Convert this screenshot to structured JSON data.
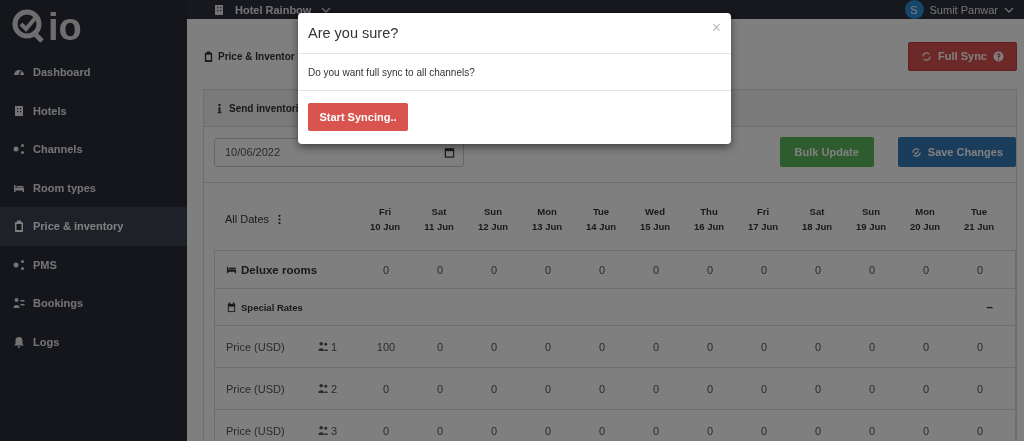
{
  "sidebar": {
    "logo": "io",
    "items": [
      {
        "label": "Dashboard",
        "selected": false
      },
      {
        "label": "Hotels",
        "selected": false
      },
      {
        "label": "Channels",
        "selected": false
      },
      {
        "label": "Room types",
        "selected": false
      },
      {
        "label": "Price & inventory",
        "selected": true
      },
      {
        "label": "PMS",
        "selected": false
      },
      {
        "label": "Bookings",
        "selected": false
      },
      {
        "label": "Logs",
        "selected": false
      }
    ]
  },
  "topbar": {
    "hotel": "Hotel Rainbow",
    "user": {
      "initial": "S",
      "name": "Sumit Panwar"
    }
  },
  "page": {
    "title": "Price & Inventor",
    "full_sync": "Full Sync",
    "card": {
      "title": "Send inventori",
      "date": "10/06/2022",
      "bulk_update": "Bulk Update",
      "save_changes": "Save Changes",
      "all_dates": "All Dates",
      "dates": [
        {
          "day": "Fri",
          "date": "10 Jun"
        },
        {
          "day": "Sat",
          "date": "11 Jun"
        },
        {
          "day": "Sun",
          "date": "12 Jun"
        },
        {
          "day": "Mon",
          "date": "13 Jun"
        },
        {
          "day": "Tue",
          "date": "14 Jun"
        },
        {
          "day": "Wed",
          "date": "15 Jun"
        },
        {
          "day": "Thu",
          "date": "16 Jun"
        },
        {
          "day": "Fri",
          "date": "17 Jun"
        },
        {
          "day": "Sat",
          "date": "18 Jun"
        },
        {
          "day": "Sun",
          "date": "19 Jun"
        },
        {
          "day": "Mon",
          "date": "20 Jun"
        },
        {
          "day": "Tue",
          "date": "21 Jun"
        }
      ],
      "room": {
        "name": "Deluxe rooms",
        "values": [
          "0",
          "0",
          "0",
          "0",
          "0",
          "0",
          "0",
          "0",
          "0",
          "0",
          "0",
          "0"
        ]
      },
      "special_rates": {
        "title": "Special Rates",
        "collapse": "–"
      },
      "rows": [
        {
          "label": "Price (USD)",
          "guests": "1",
          "values": [
            "100",
            "0",
            "0",
            "0",
            "0",
            "0",
            "0",
            "0",
            "0",
            "0",
            "0",
            "0"
          ]
        },
        {
          "label": "Price (USD)",
          "guests": "2",
          "values": [
            "0",
            "0",
            "0",
            "0",
            "0",
            "0",
            "0",
            "0",
            "0",
            "0",
            "0",
            "0"
          ]
        },
        {
          "label": "Price (USD)",
          "guests": "3",
          "values": [
            "0",
            "0",
            "0",
            "0",
            "0",
            "0",
            "0",
            "0",
            "0",
            "0",
            "0",
            "0"
          ]
        }
      ]
    }
  },
  "modal": {
    "title": "Are you sure?",
    "close": "×",
    "message": "Do you want full sync to all channels?",
    "confirm": "Start Syncing.."
  }
}
